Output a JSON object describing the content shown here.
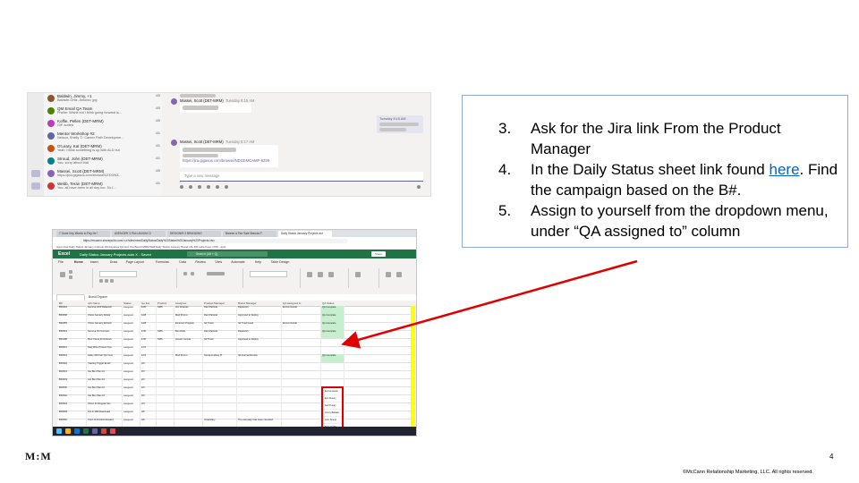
{
  "slide": {
    "page_number": "4",
    "logo_text": "M:M",
    "copyright": "©McCann Relationship Marketing, LLC. All rights reserved."
  },
  "steps": [
    {
      "number": "3.",
      "text": "Ask for the Jira link From the Product Manager"
    },
    {
      "number": "4.",
      "text_before": "In the Daily Status sheet link found ",
      "link": "here",
      "text_after": ". Find the campaign based on the B#."
    },
    {
      "number": "5.",
      "text": "Assign to yourself from the dropdown menu, under “QA assigned to” column"
    }
  ],
  "teams": {
    "chat_list": [
      {
        "name": "Baldwin, Jimmy, +1",
        "preview": "Baldwin-Ortiz, Antonio: jpg",
        "date": "4/5",
        "color": "#8e562e"
      },
      {
        "name": "QM Email QA Team",
        "preview": "Phebe: Wishit but I think going forward is...",
        "date": "4/5",
        "color": "#498205"
      },
      {
        "name": "Koffie, Pellen (DET-MRM)",
        "preview": "GIF-sorted",
        "date": "4/5",
        "color": "#c239b3"
      },
      {
        "name": "Mentor Workshop #2",
        "preview": "Nelson, Shelly T.: Career Path Developme...",
        "date": "4/1",
        "color": "#6264a7"
      },
      {
        "name": "O'Leary, Kat (DET-MRM)",
        "preview": "Yeah I think something is up with ALD but",
        "date": "4/1",
        "color": "#ca5010"
      },
      {
        "name": "Stroud, John (DET-MRM)",
        "preview": "You: sorry about that",
        "date": "4/1",
        "color": "#038387"
      },
      {
        "name": "Massei, Scott (DET-MRM)",
        "preview": "https://jira.gigasos.com/browse/LEDGN3...",
        "date": "4/5",
        "color": "#8764b8"
      },
      {
        "name": "Webb, Teran (DET-MRM)",
        "preview": "You: all have been in all day too. So f...",
        "date": "4/1",
        "color": "#d13438"
      }
    ],
    "messages": [
      {
        "author": "Massei, Scott (DET-MRM)",
        "time": "Tuesday 8:15 AM"
      },
      {
        "author": "Massei, Scott (DET-MRM)",
        "time": "Tuesday 8:17 AM",
        "link": "https://jira.gigasos.com/browse/NDGEMCAMP-6299"
      }
    ],
    "right_bubble_time": "Tuesday 8:15 AM",
    "compose_placeholder": "Type a new message"
  },
  "excel": {
    "browser_tabs": [
      "7 Gone Key Words to Pay for !",
      "AVENGER 3 PALLADIUM CI",
      "DESIGNIR 3 BRANDING",
      "Banner a Fire Sale Brenda P",
      "Daily Status January Projects aut"
    ],
    "url": "https://mccann.sharepoint.com/:x:/r/sites/mrm/DailyStatus/Daily%20Status%20January%20Projects.xlsx",
    "bookmarks": "Apps  Intel  Daily Status January  Outlook  Workspaces  QA and Jira Board  MRM Wall  Daily Status January  Brand Life  FM Labs  Keep 1700 - appr...",
    "app_name": "Excel",
    "doc_title": "Daily Status January Projects auto X  -  Saved",
    "search_placeholder": "Search (Alt + Q)",
    "share_label": "Share",
    "menu": [
      "File",
      "Home",
      "Insert",
      "Draw",
      "Page Layout",
      "Formulas",
      "Data",
      "Review",
      "View",
      "Automate",
      "Help",
      "Table Design"
    ],
    "name_box": "Brand Orgoner",
    "column_headers": [
      "B#",
      "Job Name",
      "Status",
      "Go live",
      "Product",
      "Assignee",
      "Product Manager",
      "Brand Manager",
      "QA assigned to",
      "QA Status"
    ],
    "rows": [
      [
        "B00432",
        "Gemma HCP Relaunch",
        "Assigned",
        "1/20",
        "SMS",
        "Jen Kutanas",
        "Dani Patriota",
        "Replenish",
        "Emma Goode",
        "QA Complete"
      ],
      [
        "B00508",
        "Chore January Refuel",
        "Assigned",
        "1/28",
        "",
        "Mod Promo",
        "Dani Patriota",
        "Approved to Deploy",
        "",
        "QA Complete"
      ],
      [
        "B00455",
        "Chore January Refresh",
        "Assigned",
        "1/28",
        "",
        "Emerson Program",
        "Gil Truett",
        "Gil Truett Lead",
        "Emma Goode",
        "QA Complete"
      ],
      [
        "B00519",
        "Gemma VH Connect",
        "Assigned",
        "1/30",
        "SMS",
        "Ben Rolie",
        "Dani Patriota",
        "Replenish",
        "",
        "QA Complete"
      ],
      [
        "B00498",
        "Bent Chore 40 Refresh",
        "Assigned",
        "1/30",
        "SMS",
        "Anselm Goode",
        "Gil Truett",
        "Approved to Deploy",
        "",
        ""
      ],
      [
        "B00510",
        "Stay Wise Product Ops",
        "Assigned",
        "1/31",
        "",
        "",
        "",
        "",
        "",
        ""
      ],
      [
        "B00521",
        "Haley 200 Fair Opt Core",
        "Assigned",
        "1/31",
        "",
        "Mod Promo",
        "Sousa Lindsay Pt",
        "Gil Internal Review",
        "",
        "QA Complete"
      ],
      [
        "B00526",
        "Yearling Trigger Email",
        "Assigned",
        "2/3",
        "",
        "",
        "",
        "",
        "",
        ""
      ],
      [
        "B00531",
        "Jan Ben Plan Fri",
        "Assigned",
        "2/3",
        "",
        "",
        "",
        "",
        "",
        ""
      ],
      [
        "B00533",
        "Jan Ben Plan Fri",
        "Assigned",
        "2/3",
        "",
        "",
        "",
        "",
        "",
        ""
      ],
      [
        "B00536",
        "Jan Ben Plan Fri",
        "Assigned",
        "2/3",
        "",
        "",
        "",
        "",
        "",
        ""
      ],
      [
        "B00540",
        "Jan Ben Plan Fri",
        "Assigned",
        "2/3",
        "",
        "",
        "",
        "",
        "",
        ""
      ],
      [
        "B00544",
        "Chore Fri Regular Sim",
        "Assigned",
        "2/4",
        "",
        "",
        "",
        "",
        "",
        ""
      ],
      [
        "B00548",
        "Opt In Mid Reanimate",
        "Assigned",
        "2/5",
        "",
        "",
        "",
        "",
        "",
        ""
      ],
      [
        "B00550",
        "Yield JA Product Reward",
        "Assigned",
        "2/6",
        "",
        "",
        "Unsanitary",
        "The campaign has been canceled",
        "",
        ""
      ]
    ],
    "dropdown_options": [
      "Emma Goode",
      "Erin Khoury",
      "Kat O'Leary",
      "Jimmy Baldwin",
      "John Stroud",
      "Pellen Koffie",
      "Scott Massei",
      "Teran Webb",
      "Antonio Ortiz",
      "Jeni Kutanas",
      "Phebe Lane"
    ]
  },
  "colors": {
    "excel_green": "#217346",
    "teams_purple": "#6264a7",
    "arrow_red": "#e00000",
    "panel_border": "#8ea9db",
    "link_blue": "#0563c1"
  }
}
